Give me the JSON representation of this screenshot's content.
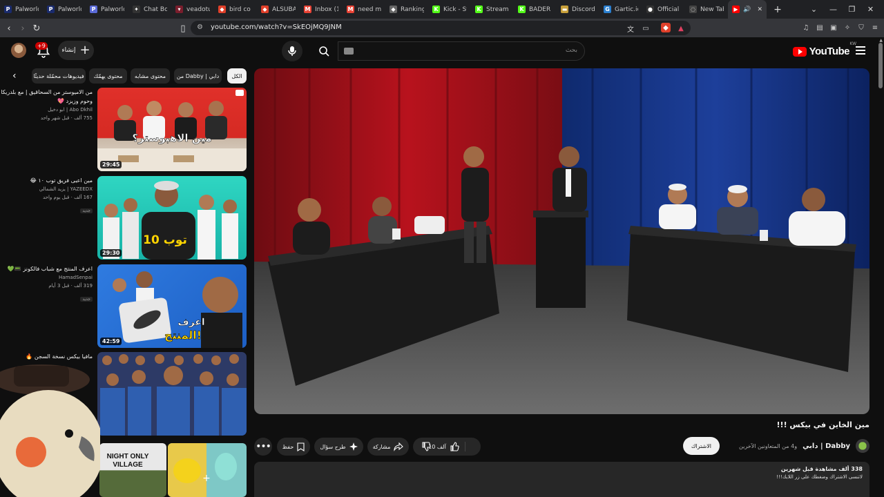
{
  "browser": {
    "tabs": [
      {
        "label": "Palworld",
        "icon": "P",
        "color": "#1a2b6d"
      },
      {
        "label": "Palworld",
        "icon": "P",
        "color": "#1a2b6d"
      },
      {
        "label": "Palworld",
        "icon": "P",
        "color": "#5a6ad8"
      },
      {
        "label": "Chat Bo",
        "icon": "✦",
        "color": "#333"
      },
      {
        "label": "veadotu",
        "icon": "▾",
        "color": "#7a1d2c"
      },
      {
        "label": "bird co",
        "icon": "◆",
        "color": "#e0402a"
      },
      {
        "label": "ALSUBA",
        "icon": "◆",
        "color": "#e0402a"
      },
      {
        "label": "Inbox (1",
        "icon": "M",
        "color": "#ea4335"
      },
      {
        "label": "need m",
        "icon": "M",
        "color": "#ea4335"
      },
      {
        "label": "Ranking",
        "icon": "◆",
        "color": "#666"
      },
      {
        "label": "Kick - St",
        "icon": "K",
        "color": "#53fc18"
      },
      {
        "label": "Stream",
        "icon": "K",
        "color": "#53fc18"
      },
      {
        "label": "BADER",
        "icon": "K",
        "color": "#53fc18"
      },
      {
        "label": "Discord",
        "icon": "▬",
        "color": "#c8a03a"
      },
      {
        "label": "Gartic.io",
        "icon": "G",
        "color": "#2a7fcf"
      },
      {
        "label": "Official",
        "icon": "●",
        "color": "#333"
      },
      {
        "label": "New Tab",
        "icon": "◌",
        "color": "#444"
      }
    ],
    "active_tab": {
      "audio": "🔊",
      "close": "✕"
    },
    "url": "youtube.com/watch?v=SkEOjMQ9JNM"
  },
  "masthead": {
    "logo": "YouTube",
    "country": "KW",
    "search_placeholder": "بحث",
    "create_label": "إنشاء",
    "notifications_badge": "+9"
  },
  "chips": [
    "الكل",
    "من Dabby | دابي",
    "محتوى مشابه",
    "محتوى يهمّك",
    "فيديوهات محمّلة حديثًا"
  ],
  "recommendations": [
    {
      "title_l1": "من الاميوستر من السحاقيق | مع بلدريكا",
      "title_l2": "وحوم وزيزد 💖",
      "channel": "Abo Dkhil | ابو دخيل",
      "stats": "755 ألف · قبل شهر واحد",
      "duration": "29:45",
      "is_new": ""
    },
    {
      "title_l1": "مين اعبى فريق توب ١٠ 😂",
      "title_l2": "",
      "channel": "YAZEEDX | يزيد الشمالي",
      "stats": "167 ألف · قبل يوم واحد",
      "duration": "29:30",
      "is_new": "جديد"
    },
    {
      "title_l1": "اعرف المنتج مع شباب فالكونز 📟💚",
      "title_l2": "",
      "channel": "HamadSenpai",
      "stats": "319 ألف · قبل 3 أيام",
      "duration": "42:59",
      "is_new": "جديد"
    },
    {
      "title_l1": "مافيا بيكس نسخة السجن 🔥",
      "title_l2": "",
      "channel": "",
      "stats": "",
      "duration": "",
      "is_new": ""
    }
  ],
  "thumb_texts": {
    "t1": "مين الاهبوستر؟",
    "t2": "توب 10",
    "t3a": "اعرف",
    "t3b": "المنتج!",
    "t5": "NIGHT ONLY VILLAGE"
  },
  "video": {
    "title": "مين الخاين في بيكس !!!",
    "channel": "Dabby | دابي",
    "channel_sub": "و4 من المتعاونين الآخرين",
    "subscribe": "الاشتراك",
    "likes": "10 آلف",
    "share": "مشاركة",
    "ask": "طرح سؤال",
    "save": "حفظ",
    "views": "338 ألف مشاهدة  قبل شهرين",
    "desc_line": "لاتنسى الاشتراك وضغطك على زر اللايك!!!"
  },
  "colors": {
    "accent": "#ff0000",
    "bg": "#0f0f0f",
    "chip": "#272727"
  }
}
